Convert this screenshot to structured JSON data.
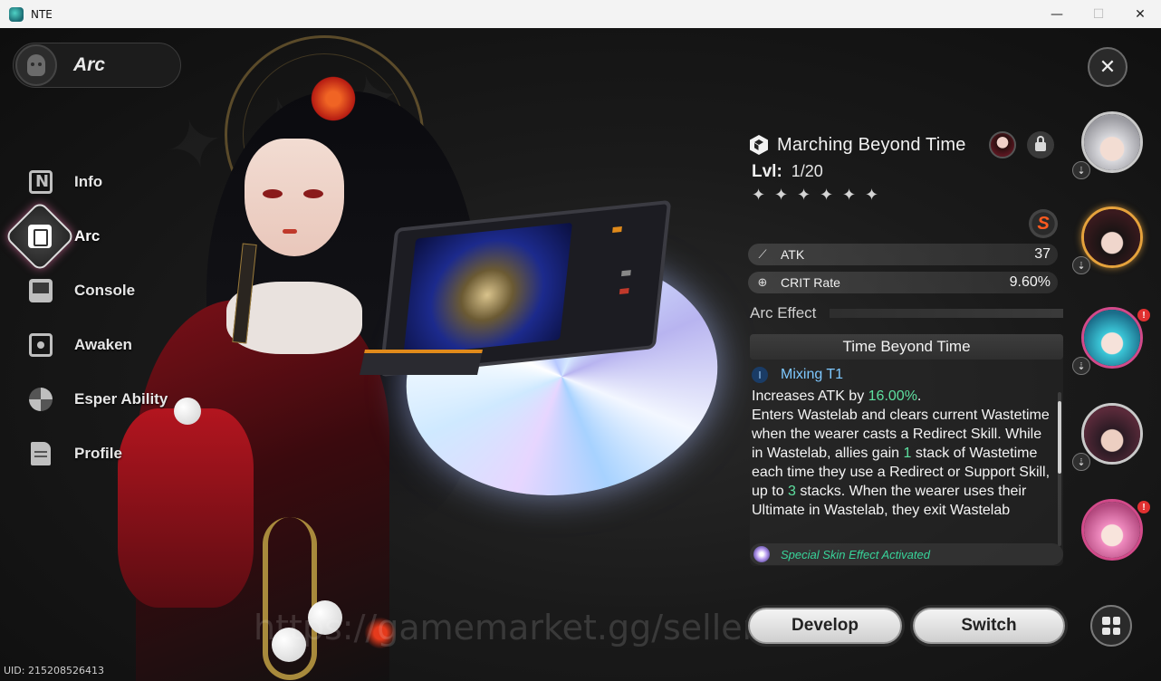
{
  "window": {
    "title": "NTE",
    "minimize": "—",
    "maximize": "☐",
    "close": "✕"
  },
  "header": {
    "title": "Arc"
  },
  "nav": {
    "items": [
      {
        "label": "Info",
        "icon": "info-icon"
      },
      {
        "label": "Arc",
        "icon": "arc-icon",
        "active": true
      },
      {
        "label": "Console",
        "icon": "console-icon"
      },
      {
        "label": "Awaken",
        "icon": "awaken-icon"
      },
      {
        "label": "Esper Ability",
        "icon": "esper-ability-icon"
      },
      {
        "label": "Profile",
        "icon": "profile-icon"
      }
    ]
  },
  "close_label": "✕",
  "arc": {
    "name": "Marching Beyond Time",
    "level_label": "Lvl:",
    "level_value": "1/20",
    "stars": [
      "✦",
      "✦",
      "✦",
      "✦",
      "✦",
      "✦"
    ],
    "rank": "S",
    "stats": [
      {
        "icon": "atk-icon",
        "symbol": "⟋",
        "name": "ATK",
        "value": "37"
      },
      {
        "icon": "crit-rate-icon",
        "symbol": "⊕",
        "name": "CRIT Rate",
        "value": "9.60%"
      }
    ],
    "effect_section_title": "Arc Effect",
    "effect_name": "Time Beyond Time",
    "tier_symbol": "I",
    "tier_name": "Mixing T1",
    "desc": {
      "p1": "Increases ATK by ",
      "p1_hl": "16.00%",
      "p1_end": ".",
      "p2": "Enters Wastelab and clears current Wastetime when the wearer casts a Redirect Skill. While in Wastelab, allies gain ",
      "p2_hl": "1",
      "p3": " stack of Wastetime each time they use a Redirect or Support Skill, up to ",
      "p3_hl": "3",
      "p4": " stacks. When the wearer uses their Ultimate in Wastelab, they exit Wastelab"
    },
    "special_effect": "Special Skin Effect Activated"
  },
  "buttons": {
    "develop": "Develop",
    "switch": "Switch"
  },
  "roster": [
    {
      "name": "white-hair-character",
      "swap": "⇣",
      "alert": false
    },
    {
      "name": "black-hair-character",
      "swap": "⇣",
      "alert": false,
      "active": true
    },
    {
      "name": "cyan-hair-character",
      "swap": "⇣",
      "alert": true
    },
    {
      "name": "dark-hair-character",
      "swap": "⇣",
      "alert": false
    },
    {
      "name": "pink-hair-character",
      "swap": "⇣",
      "alert": true
    }
  ],
  "alert_symbol": "!",
  "uid": "UID: 215208526413",
  "watermark": "https://gamemarket.gg/seller/d...",
  "colors": {
    "highlight": "#5ee0a0",
    "tier": "#7ec8ff",
    "special": "#38d49a",
    "rank": "#ff5a1f"
  }
}
